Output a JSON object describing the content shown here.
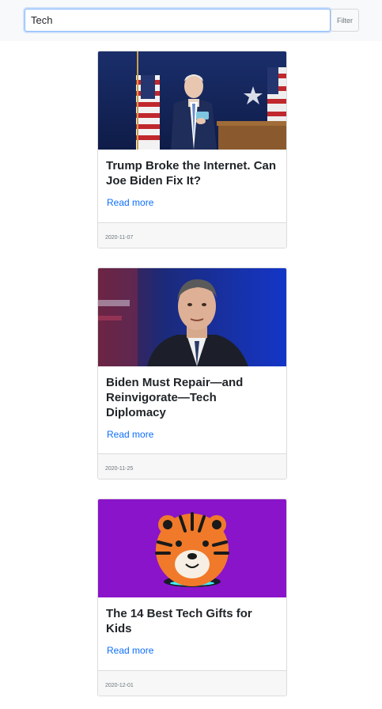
{
  "search": {
    "value": "Tech",
    "placeholder": ""
  },
  "filter_button": {
    "label": "Filter"
  },
  "articles": [
    {
      "title": "Trump Broke the Internet. Can Joe Biden Fix It?",
      "link_label": "Read more",
      "date": "2020-11-07",
      "image": "biden-podium-photo"
    },
    {
      "title": "Biden Must Repair—and Reinvigorate—Tech Diplomacy",
      "link_label": "Read more",
      "date": "2020-11-25",
      "image": "blinken-portrait-photo"
    },
    {
      "title": "The 14 Best Tech Gifts for Kids",
      "link_label": "Read more",
      "date": "2020-12-01",
      "image": "tiger-smart-speaker-photo"
    }
  ],
  "colors": {
    "link": "#0d6efd",
    "focus_border": "#86b7fe",
    "image3_bg": "#8a14c9"
  }
}
